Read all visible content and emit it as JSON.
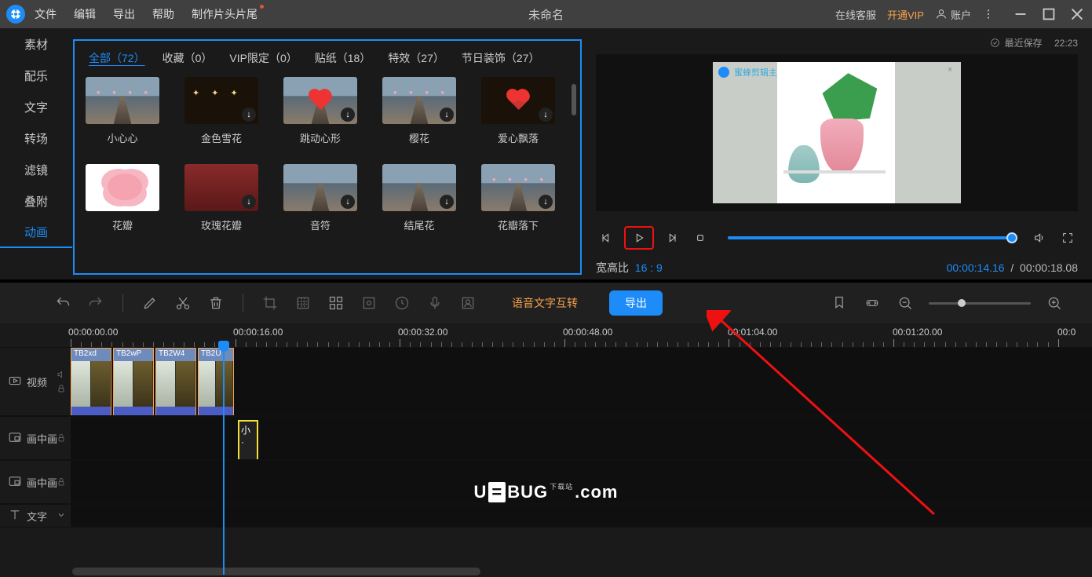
{
  "menu": {
    "file": "文件",
    "edit": "编辑",
    "export": "导出",
    "help": "帮助",
    "intro_outro": "制作片头片尾"
  },
  "title": "未命名",
  "top_right": {
    "support": "在线客服",
    "vip": "开通VIP",
    "account": "账户"
  },
  "last_save_label": "最近保存",
  "last_save_time": "22:23",
  "left_nav": {
    "material": "素材",
    "music": "配乐",
    "text": "文字",
    "transition": "转场",
    "filter": "滤镜",
    "overlay": "叠附",
    "animation": "动画"
  },
  "categories": {
    "all": "全部（72）",
    "favorite": "收藏（0）",
    "vip": "VIP限定（0）",
    "sticker": "贴纸（18）",
    "effect": "特效（27）",
    "holiday": "节日装饰（27）"
  },
  "items_row1": [
    {
      "label": "小心心"
    },
    {
      "label": "金色雪花"
    },
    {
      "label": "跳动心形"
    },
    {
      "label": "樱花"
    },
    {
      "label": "爱心飘落"
    }
  ],
  "items_row2": [
    {
      "label": "花瓣"
    },
    {
      "label": "玫瑰花瓣"
    },
    {
      "label": "音符"
    },
    {
      "label": "结尾花"
    },
    {
      "label": "花瓣落下"
    }
  ],
  "preview": {
    "overlay_text": "蜜蜂剪辑主",
    "ratio_label": "宽高比",
    "ratio_value": "16 : 9",
    "time_current": "00:00:14.16",
    "time_total": "00:00:18.08"
  },
  "toolbar": {
    "voice_conv": "语音文字互转",
    "export": "导出"
  },
  "ruler_labels": {
    "t0": "00:00:00.00",
    "t1": "00:00:16.00",
    "t2": "00:00:32.00",
    "t3": "00:00:48.00",
    "t4": "00:01:04.00",
    "t5": "00:01:20.00",
    "t6": "00:0"
  },
  "tracks": {
    "video": "视频",
    "pip": "画中画",
    "textTrack": "文字"
  },
  "clips": {
    "c1": "TB2xd",
    "c2": "TB2wP",
    "c3": "TB2W4",
    "c4": "TB2U",
    "overlay": "小"
  },
  "watermark": {
    "a": "U",
    "b": "=",
    "c": "BUG",
    "sub": "下载站",
    "d": ".com"
  }
}
